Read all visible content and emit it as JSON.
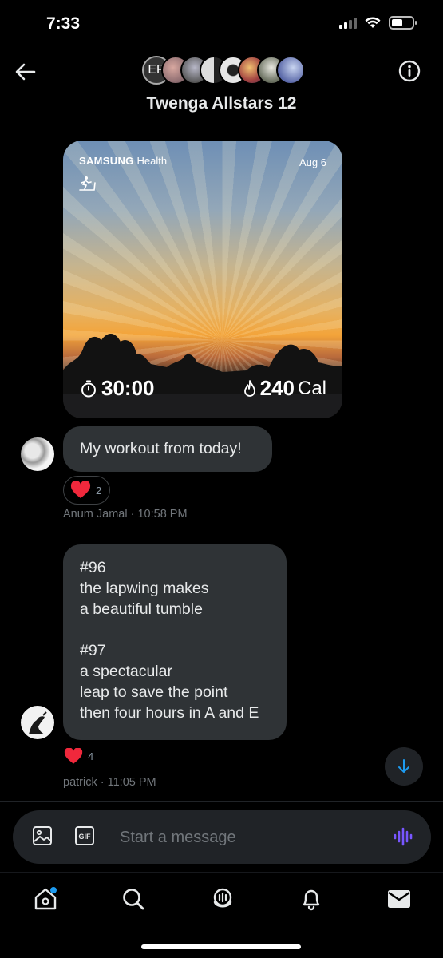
{
  "status_bar": {
    "time": "7:33"
  },
  "header": {
    "title": "Twenga Allstars 12",
    "avatar_initials": "EP"
  },
  "health_card": {
    "brand_primary": "SAMSUNG",
    "brand_secondary": "Health",
    "date": "Aug 6",
    "duration": "30:00",
    "calories_value": "240",
    "calories_unit": "Cal"
  },
  "messages": [
    {
      "text": "My workout from today!",
      "reaction_count": "2",
      "sender": "Anum Jamal",
      "time": "10:58 PM"
    },
    {
      "lines": [
        "#96",
        "the lapwing makes",
        "a beautiful tumble",
        "",
        "#97",
        "a spectacular",
        "leap to save the point",
        "then four hours in A and E"
      ],
      "reaction_count": "4",
      "sender": "patrick",
      "time": "11:05 PM"
    }
  ],
  "composer": {
    "placeholder": "Start a message"
  },
  "icons": {
    "back": "back-arrow-icon",
    "info": "info-icon",
    "gallery": "image-icon",
    "gif": "gif-icon",
    "voice": "voice-wave-icon",
    "home": "home-icon",
    "search": "search-icon",
    "spaces": "spaces-icon",
    "notifications": "bell-icon",
    "messages": "mail-icon"
  },
  "colors": {
    "bubble": "#2f3336",
    "accent_blue": "#1d9bf0",
    "voice_purple": "#7856ff",
    "heart_red": "#f91880"
  }
}
